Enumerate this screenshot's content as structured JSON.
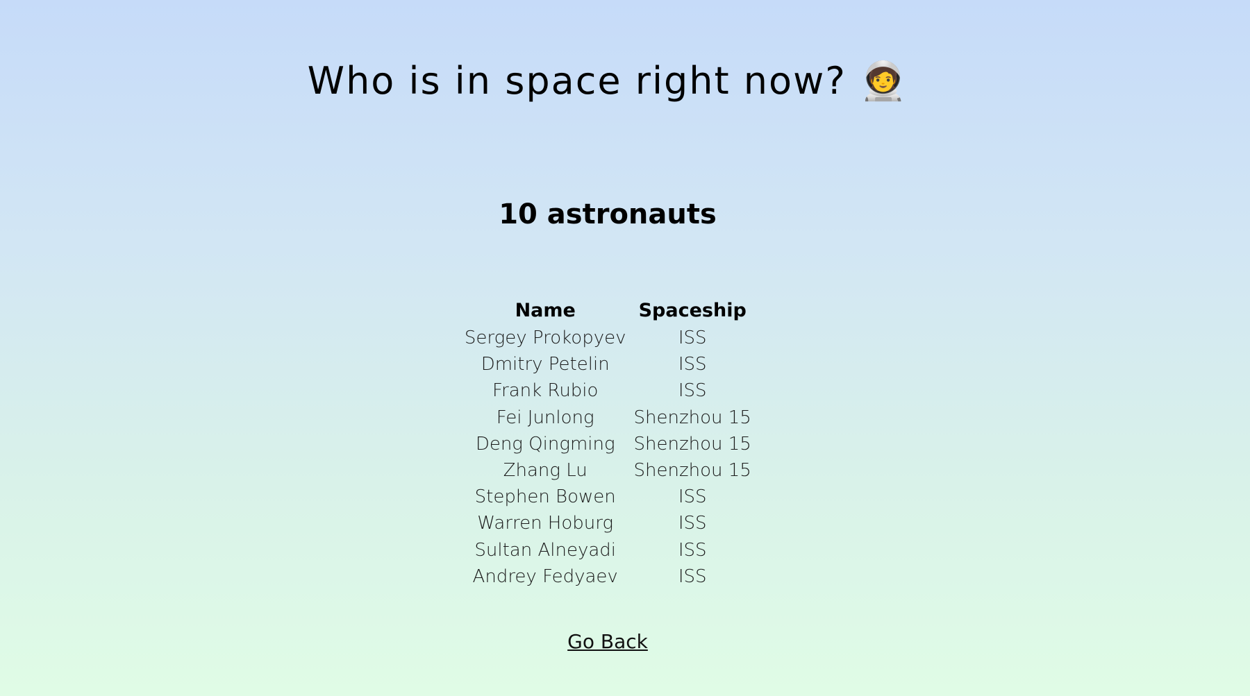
{
  "header": {
    "title": "Who is in space right now? 🧑‍🚀"
  },
  "summary": {
    "count_text": "10 astronauts"
  },
  "table": {
    "columns": [
      "Name",
      "Spaceship"
    ],
    "rows": [
      [
        "Sergey Prokopyev",
        "ISS"
      ],
      [
        "Dmitry Petelin",
        "ISS"
      ],
      [
        "Frank Rubio",
        "ISS"
      ],
      [
        "Fei Junlong",
        "Shenzhou 15"
      ],
      [
        "Deng Qingming",
        "Shenzhou 15"
      ],
      [
        "Zhang Lu",
        "Shenzhou 15"
      ],
      [
        "Stephen Bowen",
        "ISS"
      ],
      [
        "Warren Hoburg",
        "ISS"
      ],
      [
        "Sultan Alneyadi",
        "ISS"
      ],
      [
        "Andrey Fedyaev",
        "ISS"
      ]
    ]
  },
  "footer": {
    "back_link": "Go Back"
  }
}
